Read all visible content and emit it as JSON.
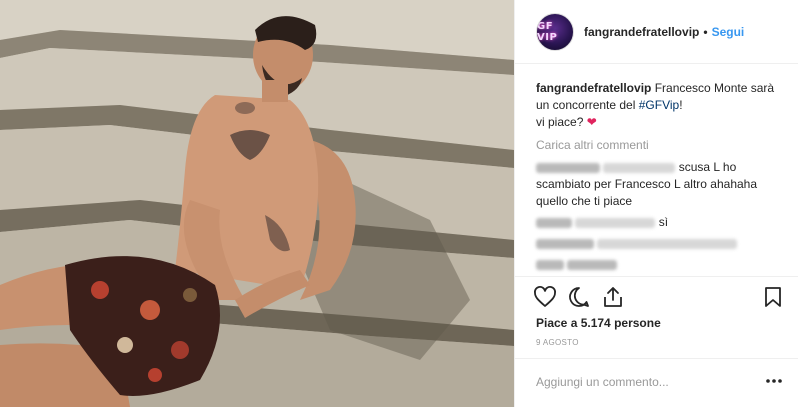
{
  "header": {
    "avatar_text": "GF VIP",
    "username": "fangrandefratellovip",
    "separator": "•",
    "follow_label": "Segui"
  },
  "caption": {
    "username": "fangrandefratellovip",
    "text": "Francesco Monte sarà un concorrente del ",
    "hashtag": "#GFVip",
    "text2": "!",
    "line2": "vi piace? ",
    "heart": "❤"
  },
  "load_more": "Carica altri commenti",
  "comments": [
    {
      "text": "scusa L ho scambiato per Francesco L altro ahahaha quello che ti piace"
    },
    {
      "text": "sì"
    },
    {
      "text": "...grande grande grande"
    }
  ],
  "actions": {
    "like_icon": "heart-outline-icon",
    "comment_icon": "comment-bubble-icon",
    "share_icon": "share-upload-icon",
    "save_icon": "bookmark-icon"
  },
  "likes": "Piace a 5.174 persone",
  "date": "9 AGOSTO",
  "add_comment": {
    "placeholder": "Aggiungi un commento..."
  },
  "more_icon": "more-dots-icon",
  "colors": {
    "link": "#3897f0",
    "hashtag": "#003569",
    "heart": "#e0245e",
    "muted": "#999999"
  }
}
